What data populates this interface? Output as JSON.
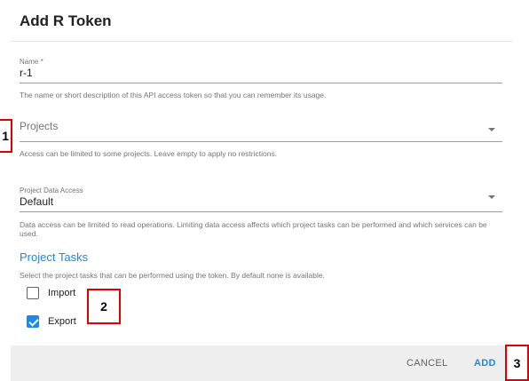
{
  "dialog": {
    "title": "Add R Token"
  },
  "name_field": {
    "label": "Name *",
    "value": "r-1",
    "hint": "The name or short description of this API access token so that you can remember its usage."
  },
  "projects_field": {
    "placeholder": "Projects",
    "hint": "Access can be limited to some projects. Leave empty to apply no restrictions."
  },
  "data_access_field": {
    "label": "Project Data Access",
    "value": "Default",
    "hint": "Data access can be limited to read operations. Limiting data access affects which project tasks can be performed and which services can be used."
  },
  "project_tasks": {
    "title": "Project Tasks",
    "description": "Select the project tasks that can be performed using the token. By default none is available.",
    "options": [
      {
        "label": "Import",
        "checked": false
      },
      {
        "label": "Export",
        "checked": true
      }
    ]
  },
  "annotations": {
    "box1": "1",
    "box2": "2",
    "box3": "3"
  },
  "footer": {
    "cancel_label": "CANCEL",
    "add_label": "ADD"
  },
  "colors": {
    "accent": "#1e88e5",
    "annotation_red": "#e00000"
  }
}
